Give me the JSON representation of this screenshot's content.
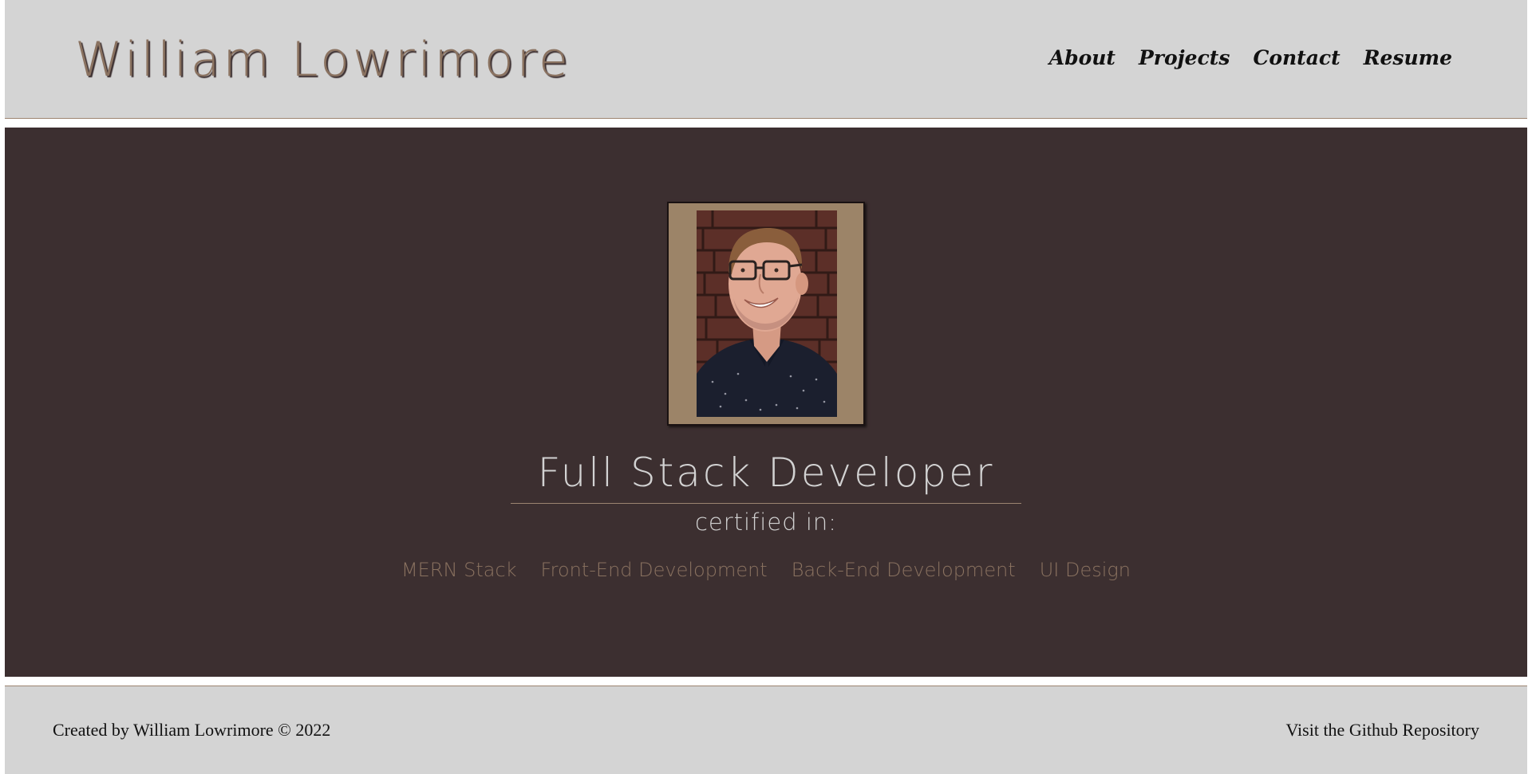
{
  "header": {
    "site_title": "William Lowrimore",
    "nav": [
      "About",
      "Projects",
      "Contact",
      "Resume"
    ]
  },
  "hero": {
    "photo_alt": "Portrait of William Lowrimore",
    "role_title": "Full Stack Developer",
    "certified_label": "certified in:",
    "certifications": [
      "MERN Stack",
      "Front-End Development",
      "Back-End Development",
      "UI Design"
    ]
  },
  "footer": {
    "credit": "Created by William Lowrimore © 2022",
    "repo_link": "Visit the Github Repository"
  },
  "colors": {
    "header_bg": "#d4d4d4",
    "hero_bg": "#3c2f30",
    "accent": "#8a7260",
    "frame": "#9c8468",
    "text_light": "#d2d2d2"
  }
}
